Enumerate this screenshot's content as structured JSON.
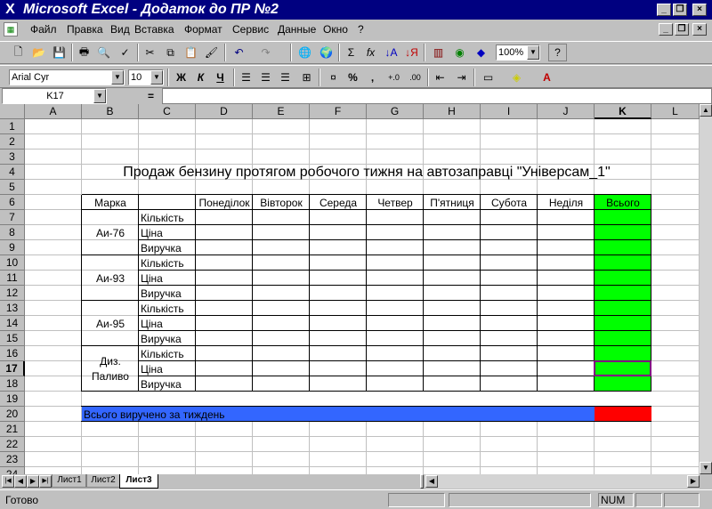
{
  "window": {
    "title": "Microsoft Excel - Додаток до ПР №2"
  },
  "menu": [
    "Файл",
    "Правка",
    "Вид",
    "Вставка",
    "Формат",
    "Сервис",
    "Данные",
    "Окно",
    "?"
  ],
  "toolbar": {
    "zoom": "100%",
    "font_name": "Arial Cyr",
    "font_size": "10",
    "bold": "Ж",
    "italic": "К",
    "underline": "Ч",
    "percent": "%",
    "comma": ",",
    "sigma": "Σ",
    "fx": "fx"
  },
  "formula_bar": {
    "name_box": "K17",
    "equals": "="
  },
  "columns": [
    "A",
    "B",
    "C",
    "D",
    "E",
    "F",
    "G",
    "H",
    "I",
    "J",
    "K",
    "L"
  ],
  "rows": [
    "1",
    "2",
    "3",
    "4",
    "5",
    "6",
    "7",
    "8",
    "9",
    "10",
    "11",
    "12",
    "13",
    "14",
    "15",
    "16",
    "17",
    "18",
    "19",
    "20",
    "21",
    "22",
    "23",
    "24"
  ],
  "sheet": {
    "title": "Продаж бензину протягом робочого тижня на автозаправці \"Універсам_1\"",
    "header_brand": "Марка",
    "days": [
      "Понеділок",
      "Вівторок",
      "Середа",
      "Четвер",
      "П'ятниця",
      "Субота",
      "Неділя"
    ],
    "total_header": "Всього",
    "brands": [
      "Аи-76",
      "Аи-93",
      "Аи-95",
      "Диз.",
      "Паливо"
    ],
    "metrics": [
      "Кількість",
      "Ціна",
      "Виручка"
    ],
    "week_total_label": "Всього виручено за тиждень"
  },
  "sheet_tabs": [
    "Лист1",
    "Лист2",
    "Лист3"
  ],
  "status": {
    "ready": "Готово",
    "num": "NUM"
  },
  "colors": {
    "green": "#00ff00",
    "blue": "#3366ff",
    "red": "#ff0000",
    "title_bar": "#000080"
  }
}
